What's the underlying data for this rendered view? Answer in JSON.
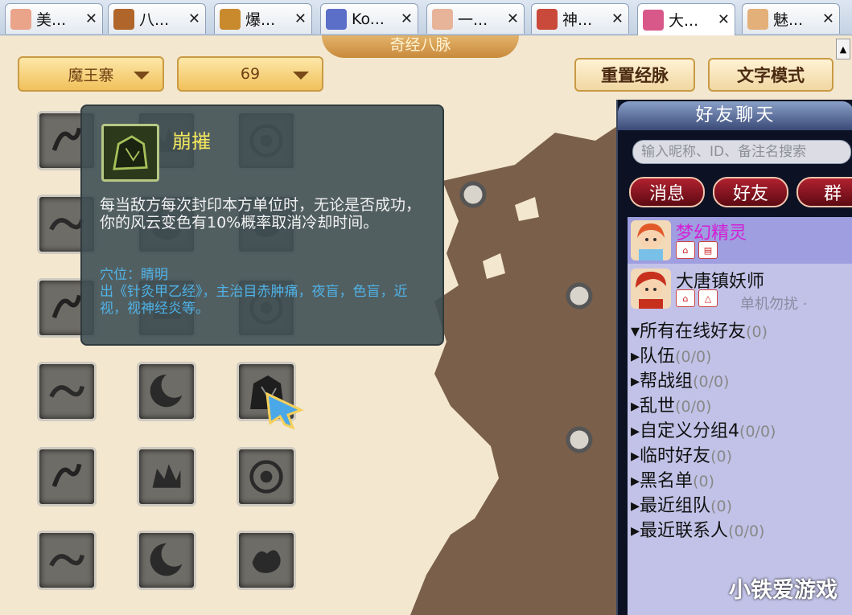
{
  "tabs": [
    {
      "label": "美...",
      "color": "#e9a48a"
    },
    {
      "label": "八...",
      "color": "#b0662a"
    },
    {
      "label": "爆...",
      "color": "#c98a2e"
    },
    {
      "label": "Ko...",
      "color": "#5b6fc9"
    },
    {
      "label": "一...",
      "color": "#e7b49a"
    },
    {
      "label": "神...",
      "color": "#c94a3a"
    },
    {
      "label": "大...",
      "color": "#d9588a"
    },
    {
      "label": "魅...",
      "color": "#e3b07a"
    }
  ],
  "window": {
    "title": "奇经八脉",
    "dropdown_school": "魔王寨",
    "dropdown_level": "69",
    "reset_button": "重置经脉",
    "text_mode_button": "文字模式"
  },
  "tooltip": {
    "name": "崩摧",
    "desc": "每当敌方每次封印本方单位时，无论是否成功，你的风云变色有10%概率取消冷却时间。",
    "acupoint": "穴位：睛明",
    "source": "出《针灸甲乙经》，主治目赤肿痛，夜盲，色盲，近视，视神经炎等。"
  },
  "chat": {
    "title": "好友聊天",
    "search_placeholder": "输入昵称、ID、备注名搜索",
    "tab_messages": "消息",
    "tab_friends": "好友",
    "tab_groups": "群",
    "friends": [
      {
        "name": "梦幻精灵",
        "status": "",
        "name_color": "#d41fd4"
      },
      {
        "name": "大唐镇妖师",
        "status": "单机勿扰 ·",
        "name_color": "#111111"
      }
    ],
    "groups": [
      {
        "label": "所有在线好友",
        "count": "(0)",
        "expanded": true
      },
      {
        "label": "队伍",
        "count": "(0/0)",
        "expanded": false
      },
      {
        "label": "帮战组",
        "count": "(0/0)",
        "expanded": false
      },
      {
        "label": "乱世",
        "count": "(0/0)",
        "expanded": false
      },
      {
        "label": "自定义分组4",
        "count": "(0/0)",
        "expanded": false
      },
      {
        "label": "临时好友",
        "count": "(0)",
        "expanded": false
      },
      {
        "label": "黑名单",
        "count": "(0)",
        "expanded": false
      },
      {
        "label": "最近组队",
        "count": "(0)",
        "expanded": false
      },
      {
        "label": "最近联系人",
        "count": "(0/0)",
        "expanded": false
      }
    ]
  },
  "watermark": "小铁爱游戏"
}
